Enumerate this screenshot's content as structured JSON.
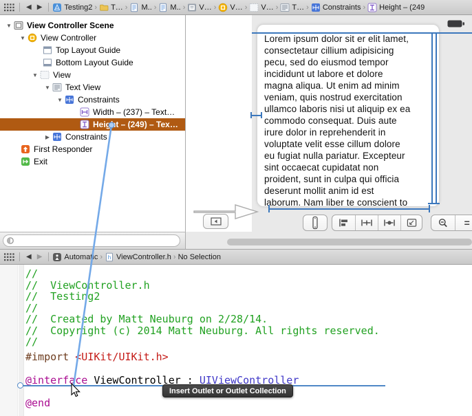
{
  "top_jump_bar": {
    "items": [
      {
        "label": "Testing2",
        "icon": "project-icon"
      },
      {
        "label": "T…",
        "icon": "folder-icon"
      },
      {
        "label": "M..",
        "icon": "document-icon"
      },
      {
        "label": "M..",
        "icon": "document-icon"
      },
      {
        "label": "V…",
        "icon": "storyboard-icon"
      },
      {
        "label": "V…",
        "icon": "view-controller-icon"
      },
      {
        "label": "V…",
        "icon": "view-icon"
      },
      {
        "label": "T…",
        "icon": "text-view-icon"
      },
      {
        "label": "Constraints",
        "icon": "constraints-icon"
      },
      {
        "label": "Height – (249",
        "icon": "height-constraint-icon"
      }
    ]
  },
  "outline": {
    "rows": [
      {
        "label": "View Controller Scene"
      },
      {
        "label": "View Controller"
      },
      {
        "label": "Top Layout Guide"
      },
      {
        "label": "Bottom Layout Guide"
      },
      {
        "label": "View"
      },
      {
        "label": "Text View"
      },
      {
        "label": "Constraints"
      },
      {
        "label": "Width – (237) – Text…"
      },
      {
        "label": "Height – (249) – Tex…"
      },
      {
        "label": "Constraints"
      },
      {
        "label": "First Responder"
      },
      {
        "label": "Exit"
      }
    ]
  },
  "canvas": {
    "text_view_lines": [
      "Lorem ipsum dolor sit er elit lamet,",
      "consectetaur cillium adipisicing",
      "pecu, sed do eiusmod tempor",
      "incididunt ut labore et dolore",
      "magna aliqua. Ut enim ad minim",
      "veniam, quis nostrud exercitation",
      "ullamco laboris nisi ut aliquip ex ea",
      "commodo consequat. Duis aute",
      "irure dolor in reprehenderit in",
      "voluptate velit esse cillum dolore",
      "eu fugiat nulla pariatur. Excepteur",
      "sint occaecat cupidatat non",
      "proident, sunt in culpa qui officia",
      "deserunt mollit anim id est",
      "laborum. Nam liber te conscient to"
    ]
  },
  "assistant_jump_bar": {
    "mode": "Automatic",
    "file": "ViewController.h",
    "selection": "No Selection"
  },
  "code": {
    "comment_lines": [
      "//",
      "//  ViewController.h",
      "//  Testing2",
      "//",
      "//  Created by Matt Neuburg on 2/28/14.",
      "//  Copyright (c) 2014 Matt Neuburg. All rights reserved.",
      "//"
    ],
    "import": {
      "directive": "#import ",
      "header": "<UIKit/UIKit.h>"
    },
    "interface": {
      "keyword": "@interface ",
      "name": "ViewController",
      "colon": " : ",
      "superclass": "UIViewController"
    },
    "end_keyword": "@end"
  },
  "tooltip": {
    "label": "Insert Outlet or Outlet Collection"
  },
  "colors": {
    "selection_highlight": "#b05a12",
    "constraint_blue": "#3b77bc",
    "drag_line_blue": "#74a9e8",
    "comment_green": "#21a121",
    "keyword_pink": "#aa0d91",
    "string_red": "#c41a16",
    "preprocessor_brown": "#6d3c1e",
    "class_purple": "#4038c8",
    "tooltip_bg": "#3d3d3d"
  }
}
